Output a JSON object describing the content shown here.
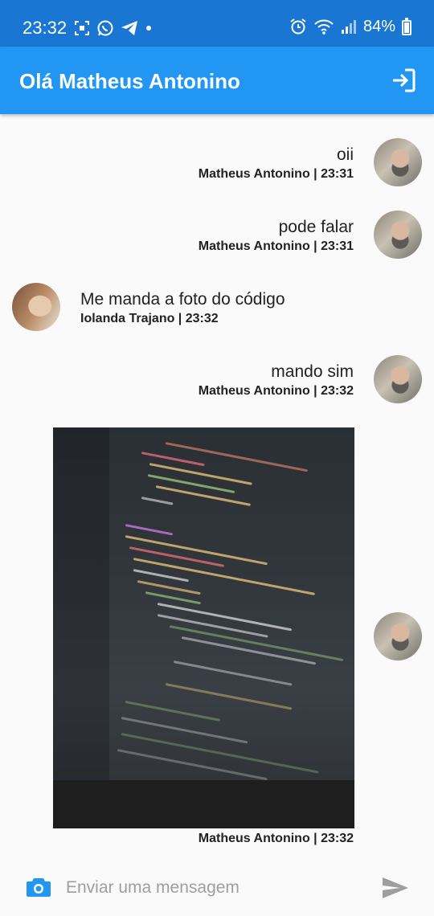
{
  "status_bar": {
    "time": "23:32",
    "battery": "84%",
    "battery_level": 0.84,
    "left_icons": [
      "screenshot-icon",
      "whatsapp-icon",
      "telegram-icon",
      "dot-icon"
    ],
    "right_icons": [
      "alarm-icon",
      "wifi-icon",
      "signal-icon"
    ]
  },
  "app_bar": {
    "title": "Olá Matheus Antonino",
    "action_icon": "logout-icon"
  },
  "messages": [
    {
      "side": "right",
      "text": "oii",
      "meta": "Matheus Antonino | 23:31"
    },
    {
      "side": "right",
      "text": "pode falar",
      "meta": "Matheus Antonino | 23:31"
    },
    {
      "side": "left",
      "text": "Me manda a foto do código",
      "meta": "Iolanda Trajano | 23:32"
    },
    {
      "side": "right",
      "text": "mando sim",
      "meta": "Matheus Antonino | 23:32"
    },
    {
      "side": "right",
      "type": "image",
      "meta": "Matheus Antonino | 23:32"
    }
  ],
  "composer": {
    "placeholder": "Enviar uma mensagem",
    "value": "",
    "camera_icon": "camera-icon",
    "send_icon": "send-icon"
  },
  "colors": {
    "status_bar": "#1976d2",
    "app_bar": "#2196f3",
    "camera": "#2196f3",
    "send": "#9e9e9e"
  }
}
